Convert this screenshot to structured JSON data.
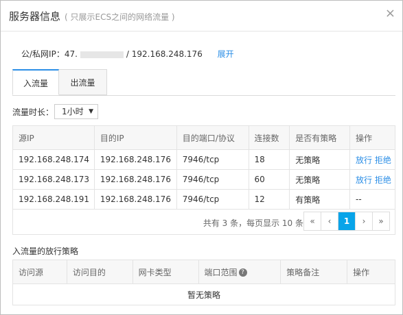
{
  "dialog": {
    "title": "服务器信息",
    "subtitle": "( 只展示ECS之间的网络流量 )",
    "close_label": "×"
  },
  "ipline": {
    "prefix": "公/私网IP：47.",
    "suffix": "/ 192.168.248.176",
    "expand_label": "展开"
  },
  "tabs": [
    {
      "label": "入流量"
    },
    {
      "label": "出流量"
    }
  ],
  "duration": {
    "label": "流量时长：",
    "value": "1小时",
    "caret": "▼"
  },
  "flow_table": {
    "headers": [
      "源IP",
      "目的IP",
      "目的端口/协议",
      "连接数",
      "是否有策略",
      "操作"
    ],
    "rows": [
      {
        "src": "192.168.248.174",
        "dst": "192.168.248.176",
        "port": "7946/tcp",
        "conn": "18",
        "policy": "无策略",
        "allow": "放行",
        "deny": "拒绝"
      },
      {
        "src": "192.168.248.173",
        "dst": "192.168.248.176",
        "port": "7946/tcp",
        "conn": "60",
        "policy": "无策略",
        "allow": "放行",
        "deny": "拒绝"
      },
      {
        "src": "192.168.248.191",
        "dst": "192.168.248.176",
        "port": "7946/tcp",
        "conn": "12",
        "policy": "有策略",
        "none": "--"
      }
    ]
  },
  "pagination": {
    "info": "共有 3 条，每页显示 10 条",
    "first": "«",
    "prev": "‹",
    "current": "1",
    "next": "›",
    "last": "»"
  },
  "policy_section": {
    "title": "入流量的放行策略",
    "headers": [
      "访问源",
      "访问目的",
      "网卡类型",
      "端口范围",
      "策略备注",
      "操作"
    ],
    "help_icon": "?",
    "empty_text": "暂无策略"
  },
  "colors": {
    "accent": "#2b8ee6",
    "pager_active": "#08a4e9"
  }
}
